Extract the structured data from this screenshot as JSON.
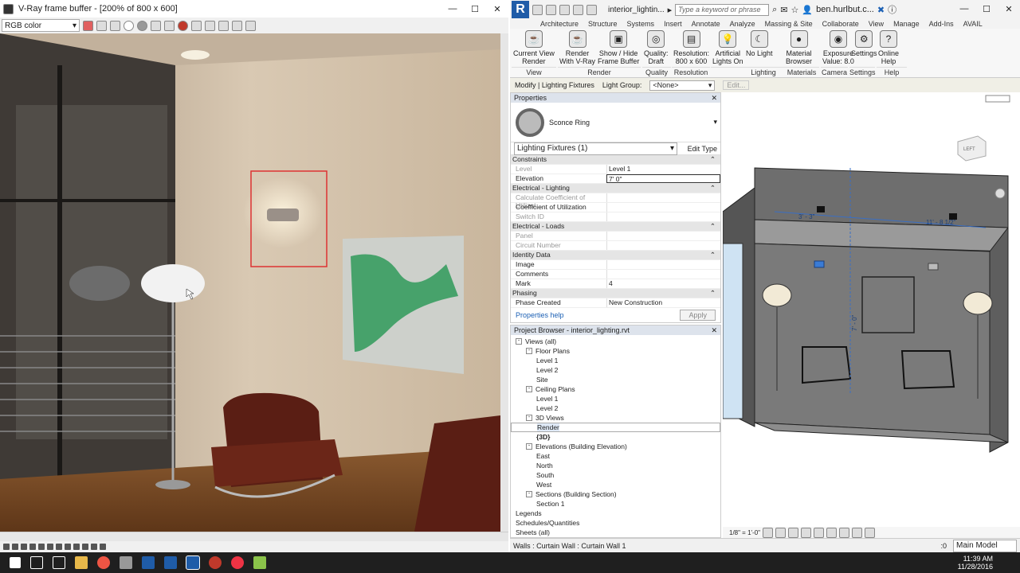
{
  "vray": {
    "title": "V-Ray frame buffer - [200% of 800 x 600]",
    "channel": "RGB color"
  },
  "revit": {
    "doc_title": "interior_lightin...",
    "search_placeholder": "Type a keyword or phrase",
    "user": "ben.hurlbut.c...",
    "tabs": [
      "Architecture",
      "Structure",
      "Systems",
      "Insert",
      "Annotate",
      "Analyze",
      "Massing & Site",
      "Collaborate",
      "View",
      "Manage",
      "Add-Ins",
      "AVAIL"
    ],
    "ribbon_buttons": [
      {
        "label": "Current View\nRender",
        "icon": "teapot-icon"
      },
      {
        "label": "Render\nWith V-Ray",
        "icon": "teapot-icon"
      },
      {
        "label": "Show / Hide\nFrame Buffer",
        "icon": "framebuffer-icon"
      },
      {
        "label": "Quality:\nDraft",
        "icon": "quality-icon"
      },
      {
        "label": "Resolution:\n800 x 600",
        "icon": "resolution-icon"
      },
      {
        "label": "Artificial\nLights On",
        "icon": "light-icon"
      },
      {
        "label": "No Light",
        "icon": "moon-icon"
      },
      {
        "label": "Material\nBrowser",
        "icon": "sphere-icon"
      },
      {
        "label": "Exposure\nValue: 8.0",
        "icon": "camera-icon"
      },
      {
        "label": "Settings",
        "icon": "gear-icon"
      },
      {
        "label": "Online\nHelp",
        "icon": "help-icon"
      }
    ],
    "ribbon_panels": [
      "View",
      "Render",
      "Quality",
      "Resolution",
      "Lighting",
      "Materials",
      "Camera",
      "Settings",
      "Help"
    ],
    "context": {
      "label": "Modify | Lighting Fixtures",
      "light_group_label": "Light Group:",
      "light_group_value": "<None>",
      "edit": "Edit..."
    },
    "properties": {
      "title": "Properties",
      "type_name": "Sconce Ring",
      "filter": "Lighting Fixtures (1)",
      "edit_type": "Edit Type",
      "rows": [
        {
          "k": "Constraints",
          "v": "",
          "sec": true
        },
        {
          "k": "Level",
          "v": "Level 1",
          "dim": true
        },
        {
          "k": "Elevation",
          "v": "7' 0\""
        },
        {
          "k": "Electrical - Lighting",
          "v": "",
          "sec": true
        },
        {
          "k": "Calculate Coefficient of Utilizat...",
          "v": "",
          "dim": true
        },
        {
          "k": "Coefficient of Utilization",
          "v": ""
        },
        {
          "k": "Switch ID",
          "v": "",
          "dim": true
        },
        {
          "k": "Electrical - Loads",
          "v": "",
          "sec": true
        },
        {
          "k": "Panel",
          "v": "",
          "dim": true
        },
        {
          "k": "Circuit Number",
          "v": "",
          "dim": true
        },
        {
          "k": "Identity Data",
          "v": "",
          "sec": true
        },
        {
          "k": "Image",
          "v": ""
        },
        {
          "k": "Comments",
          "v": ""
        },
        {
          "k": "Mark",
          "v": "4"
        },
        {
          "k": "Phasing",
          "v": "",
          "sec": true
        },
        {
          "k": "Phase Created",
          "v": "New Construction"
        }
      ],
      "help": "Properties help",
      "apply": "Apply"
    },
    "browser": {
      "title": "Project Browser - interior_lighting.rvt",
      "nodes": [
        {
          "t": "Views (all)",
          "d": 0,
          "tog": "-"
        },
        {
          "t": "Floor Plans",
          "d": 1,
          "tog": "-"
        },
        {
          "t": "Level 1",
          "d": 2
        },
        {
          "t": "Level 2",
          "d": 2
        },
        {
          "t": "Site",
          "d": 2
        },
        {
          "t": "Ceiling Plans",
          "d": 1,
          "tog": "-"
        },
        {
          "t": "Level 1",
          "d": 2
        },
        {
          "t": "Level 2",
          "d": 2
        },
        {
          "t": "3D Views",
          "d": 1,
          "tog": "-"
        },
        {
          "t": "Render",
          "d": 2,
          "sel": true
        },
        {
          "t": "{3D}",
          "d": 2,
          "bold": true
        },
        {
          "t": "Elevations (Building Elevation)",
          "d": 1,
          "tog": "-"
        },
        {
          "t": "East",
          "d": 2
        },
        {
          "t": "North",
          "d": 2
        },
        {
          "t": "South",
          "d": 2
        },
        {
          "t": "West",
          "d": 2
        },
        {
          "t": "Sections (Building Section)",
          "d": 1,
          "tog": "-"
        },
        {
          "t": "Section 1",
          "d": 2
        },
        {
          "t": "Legends",
          "d": 0
        },
        {
          "t": "Schedules/Quantities",
          "d": 0
        },
        {
          "t": "Sheets (all)",
          "d": 0
        }
      ]
    },
    "view": {
      "scale": "1/8\" = 1'-0\"",
      "dim1": "3' - 3\"",
      "dim2": "11' - 8 1/2\"",
      "dim3": "7' - 0\"",
      "viewcube": "LEFT"
    },
    "status": "Walls : Curtain Wall : Curtain Wall 1",
    "status_right": ":0",
    "model": "Main Model"
  },
  "taskbar": {
    "time": "11:39 AM",
    "date": "11/28/2016"
  }
}
